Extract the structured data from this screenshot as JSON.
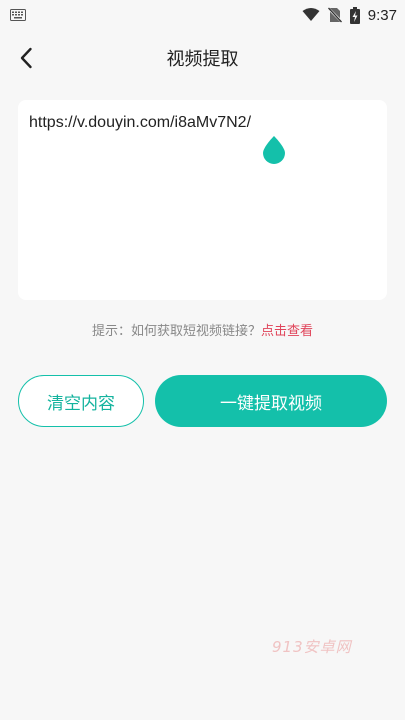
{
  "status_bar": {
    "time": "9:37",
    "icons": [
      "keyboard-icon",
      "wifi-icon",
      "no-sim-icon",
      "battery-charging-icon"
    ]
  },
  "header": {
    "title": "视频提取",
    "back_icon": "chevron-left-icon"
  },
  "input": {
    "value": "https://v.douyin.com/i8aMv7N2/"
  },
  "hint": {
    "prefix": "提示：如何获取短视频链接？",
    "link": "点击查看"
  },
  "buttons": {
    "clear": "清空内容",
    "extract": "一键提取视频"
  },
  "watermark": "913安卓网",
  "colors": {
    "accent": "#14c0aa",
    "link": "#e0445a",
    "background": "#f7f7f7"
  }
}
